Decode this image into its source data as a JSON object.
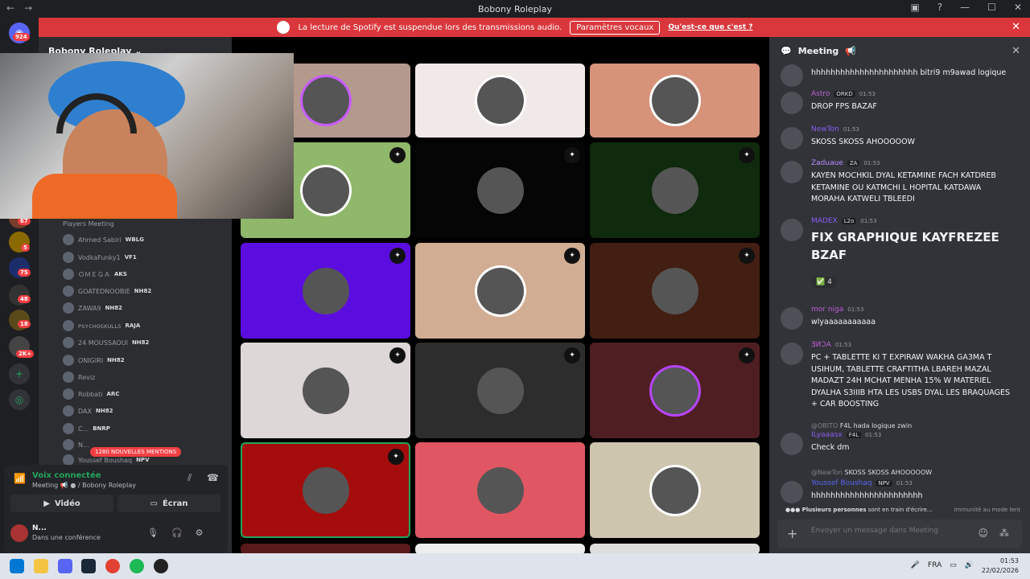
{
  "window": {
    "title": "Bobony Roleplay"
  },
  "banner": {
    "text": "La lecture de Spotify est suspendue lors des transmissions audio.",
    "button": "Paramètres vocaux",
    "link": "Qu'est-ce que c'est ?"
  },
  "servers": {
    "badges": [
      "924",
      "67",
      "5",
      "75",
      "48",
      "18",
      "2K+"
    ]
  },
  "sidebar": {
    "server_name": "Bobony Roleplay",
    "voice_channel_label": "Players Meeting",
    "members": [
      {
        "name": "Ahmed Sabiri",
        "tag": "WBLG"
      },
      {
        "name": "VodkaFunky1",
        "tag": "VF1"
      },
      {
        "name": "ＯＭＥＧＡ",
        "tag": "AKS"
      },
      {
        "name": "GOATEDNOOBIE",
        "tag": "NH82"
      },
      {
        "name": "ZAWA9",
        "tag": "NH82"
      },
      {
        "name": "ᴘsʏᴄʜᴏsᴋᴜʟʟs",
        "tag": "RAJA"
      },
      {
        "name": "24 MOUSSAOUI",
        "tag": "NH82"
      },
      {
        "name": "ONIGIRI",
        "tag": "NH82"
      },
      {
        "name": "Reviz",
        "tag": ""
      },
      {
        "name": "Robbati",
        "tag": "ARC"
      },
      {
        "name": "DAX",
        "tag": "NH82"
      },
      {
        "name": "C...",
        "tag": "BNRP"
      },
      {
        "name": "N...",
        "tag": ""
      },
      {
        "name": "Youssef Boushaq",
        "tag": "NPV"
      }
    ],
    "mentions_badge": "1280 NOUVELLES MENTIONS"
  },
  "voice": {
    "status": "Voix connectée",
    "channel": "Meeting",
    "server": "/ Bobony Roleplay",
    "video_label": "Vidéo",
    "screen_label": "Écran"
  },
  "user": {
    "name": "N...",
    "status": "Dans une conférence"
  },
  "tiles": [
    {
      "bg": "#b49a8c",
      "ring": "#c85cff",
      "label": ""
    },
    {
      "bg": "#f1e9e8",
      "ring": "#ffffff",
      "label": ""
    },
    {
      "bg": "#d6937a",
      "ring": "#ffffff",
      "label": ""
    },
    {
      "bg": "#8fb86a",
      "ring": "#ffffff",
      "label": ""
    },
    {
      "bg": "#050505",
      "ring": "#050505",
      "label": ""
    },
    {
      "bg": "#0f2a0c",
      "ring": "#0f2a0c",
      "label": ""
    },
    {
      "bg": "#5b0de0",
      "ring": "#5b0de0",
      "label": ""
    },
    {
      "bg": "#d1ad93",
      "ring": "#ffffff",
      "label": ""
    },
    {
      "bg": "#421f12",
      "ring": "#421f12",
      "label": ""
    },
    {
      "bg": "#ddd7d7",
      "ring": "#ddd7d7",
      "label": ""
    },
    {
      "bg": "#2d2d2d",
      "ring": "#2d2d2d",
      "label": ""
    },
    {
      "bg": "#4f1e23",
      "ring": "#b844ff",
      "label": ""
    },
    {
      "bg": "#a50d0d",
      "ring": "#a50d0d",
      "label": ""
    },
    {
      "bg": "#e05662",
      "ring": "#e05662",
      "label": ""
    },
    {
      "bg": "#cdc5ae",
      "ring": "#ffffff",
      "label": ""
    }
  ],
  "chat": {
    "title": "Meeting",
    "messages": [
      {
        "author": "",
        "color": "#dbdee1",
        "tag": "",
        "time": "",
        "text": "hhhhhhhhhhhhhhhhhhhhhh bitri9 m9awad logique"
      },
      {
        "author": "Astro",
        "color": "#c05fd6",
        "tag": "ORKD",
        "time": "01:53",
        "text": "DROP FPS BAZAF"
      },
      {
        "author": "NewTon",
        "color": "#8a5cf6",
        "tag": "",
        "time": "01:53",
        "text": "SKOSS SKOSS AHOOOOOW"
      },
      {
        "author": "Zaduaue",
        "color": "#b98cff",
        "tag": "ZA",
        "time": "01:53",
        "text": "KAYEN MOCHKIL DYAL KETAMINE FACH KATDREB KETAMINE OU KATMCHI L HOPITAL KATDAWA MORAHA KATWELI TBLEEDI"
      },
      {
        "author": "MADEX",
        "color": "#8a5cf6",
        "tag": "L2o",
        "time": "01:53",
        "text": "FIX GRAPHIQUE KAYFREZEE BZAF"
      },
      {
        "author": "mor niga",
        "color": "#c05fd6",
        "tag": "",
        "time": "01:53",
        "text": "wlyaaaaaaaaaaa"
      },
      {
        "author": "ƎИƆA",
        "color": "#c05fd6",
        "tag": "",
        "time": "01:53",
        "text": "PC + TABLETTE KI T EXPIRAW WAKHA GA3MA T USIHUM, TABLETTE CRAFTITHA LBAREH MAZAL MADAZT 24H MCHAT MENHA 15% W MATERIEL DYALHA S3IIIB HTA LES USBS DYAL LES BRAQUAGES + CAR BOOSTING"
      },
      {
        "author": "ILyaaasx",
        "color": "#8a5cf6",
        "tag": "F4L",
        "time": "01:53",
        "text": "Check dm"
      },
      {
        "author": "Youssef Boushaq",
        "color": "#5865f2",
        "tag": "NPV",
        "time": "01:53",
        "text": "hhhhhhhhhhhhhhhhhhhhhhh"
      }
    ],
    "reaction_count": "4",
    "replies": [
      {
        "name": "@OBITO",
        "tag": "F4L",
        "text": "hada logique zwin"
      },
      {
        "name": "@NewTon",
        "tag": "",
        "text": "SKOSS SKOSS AHOOOOOW"
      }
    ],
    "typing_who": "Plusieurs personnes",
    "typing_text": "sont en train d'écrire…",
    "immunity": "Immunité au mode lent",
    "placeholder": "Envoyer un message dans Meeting"
  },
  "taskbar": {
    "lang": "FRA",
    "time": "01:53",
    "date": "22/02/2026"
  }
}
